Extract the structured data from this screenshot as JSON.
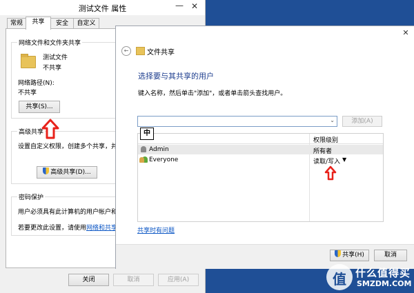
{
  "properties": {
    "title": "测试文件 属性",
    "minimize": "—",
    "close": "✕",
    "tabs": [
      "常规",
      "共享",
      "安全",
      "自定义"
    ],
    "network_section": "网络文件和文件夹共享",
    "folder_name": "测试文件",
    "folder_status": "不共享",
    "network_path_label": "网络路径(N):",
    "network_path_value": "不共享",
    "share_button": "共享(S)...",
    "advanced_section": "高级共享",
    "advanced_desc": "设置自定义权限，创建多个共享，并设",
    "advanced_button": "高级共享(D)...",
    "password_section": "密码保护",
    "password_desc": "用户必须具有此计算机的用户帐户和密",
    "password_change_prefix": "若要更改此设置，请使用",
    "password_change_link": "网络和共享中",
    "close_button": "关闭",
    "cancel_button": "取消",
    "apply_button": "应用(A)"
  },
  "share_dialog": {
    "close": "✕",
    "back": "←",
    "title": "文件共享",
    "heading": "选择要与其共享的用户",
    "description": "键入名称，然后单击\"添加\"，或者单击箭头查找用户。",
    "name_input_value": "",
    "name_input_caret": "⌄",
    "add_button": "添加(A)",
    "ime_indicator": "中",
    "table_header_permission": "权限级别",
    "rows": [
      {
        "name": "Admin",
        "permission": "所有者"
      },
      {
        "name": "Everyone",
        "permission": "读取/写入",
        "dropdown": "▼"
      }
    ],
    "help_link": "共享时有问题",
    "share_button": "共享(H)",
    "cancel_button": "取消"
  },
  "watermark": {
    "glyph": "值",
    "text_cn": "什么值得买",
    "text_en": "SMZDM.COM"
  },
  "colors": {
    "arrow": "#e8221b",
    "heading": "#1f3f8f",
    "link": "#0a55c4",
    "desktop_blue": "#1f4f96"
  }
}
